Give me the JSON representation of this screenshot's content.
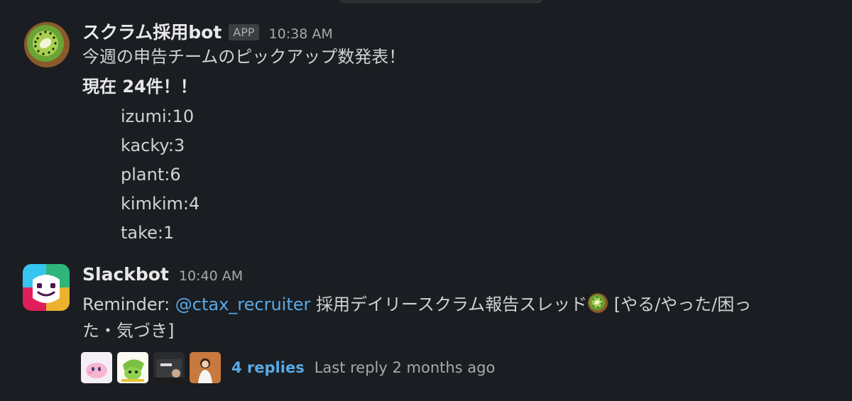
{
  "messages": [
    {
      "author": "スクラム採用bot",
      "badge": "APP",
      "time": "10:38 AM",
      "avatar_icon": "kiwi-icon",
      "lines": {
        "intro": "今週の申告チームのピックアップ数発表！",
        "total": "現在 24件！！",
        "counts": [
          "izumi:10",
          "kacky:3",
          "plant:6",
          "kimkim:4",
          "take:1"
        ]
      }
    },
    {
      "author": "Slackbot",
      "time": "10:40 AM",
      "avatar_icon": "slackbot-icon",
      "reminder_prefix": "Reminder: ",
      "mention": "@ctax_recruiter",
      "reminder_text": " 採用デイリースクラム報告スレッド",
      "reminder_suffix": " [やる/やった/困っ",
      "reminder_line2": "た・気づき]",
      "inline_icon": "kiwi-icon",
      "thread": {
        "reply_count": "4 replies",
        "last_reply": "Last reply 2 months ago",
        "participant_icons": [
          "pink-blob-avatar",
          "green-character-avatar",
          "freee-shirt-avatar",
          "person-avatar"
        ]
      }
    }
  ],
  "colors": {
    "background": "#1a1d21",
    "link": "#5aa9e6",
    "text": "#d1d2d3"
  }
}
